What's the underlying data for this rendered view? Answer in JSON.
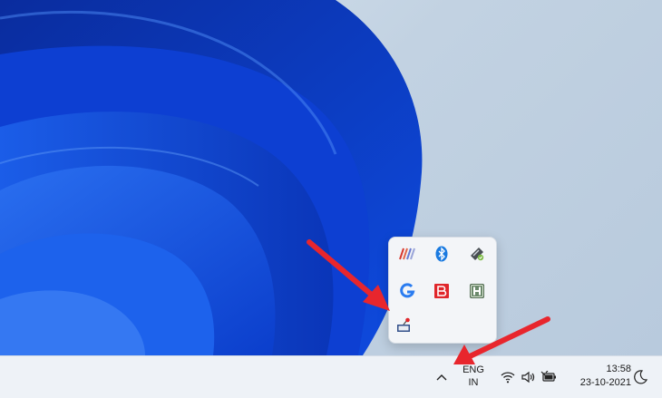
{
  "taskbar": {
    "language": {
      "line1": "ENG",
      "line2": "IN"
    },
    "clock": {
      "time": "13:58",
      "date": "23-10-2021"
    },
    "tray_icons": [
      "wifi-icon",
      "speaker-icon",
      "battery-icon"
    ]
  },
  "overflow_menu": {
    "icons": [
      "streak-app-icon",
      "bluetooth-icon",
      "safely-remove-hardware-icon",
      "logitech-g-hub-icon",
      "bitdefender-icon",
      "hotspot-shield-icon",
      "printer-status-icon"
    ]
  },
  "colors": {
    "accent_arrow": "#e8262d",
    "wallpaper_blue": "#0b3fc9",
    "taskbar_bg": "#eef2f7"
  }
}
